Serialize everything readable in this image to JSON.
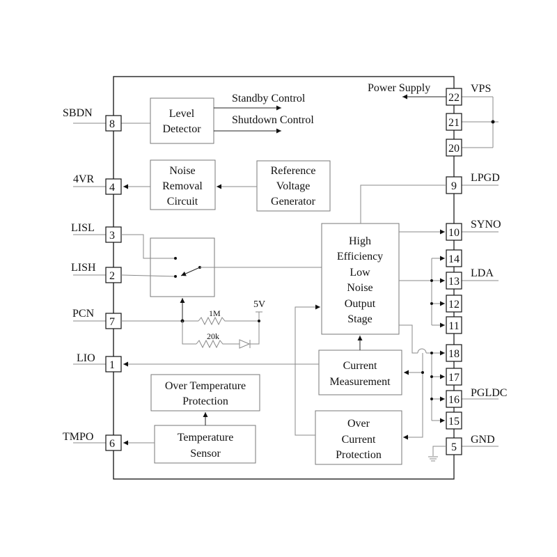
{
  "left_pins": [
    {
      "num": "8",
      "label": "SBDN"
    },
    {
      "num": "4",
      "label": "4VR"
    },
    {
      "num": "3",
      "label": "LISL"
    },
    {
      "num": "2",
      "label": "LISH"
    },
    {
      "num": "7",
      "label": "PCN"
    },
    {
      "num": "1",
      "label": "LIO"
    },
    {
      "num": "6",
      "label": "TMPO"
    }
  ],
  "right_pins": [
    "22",
    "21",
    "20",
    "9",
    "10",
    "14",
    "13",
    "12",
    "11",
    "18",
    "17",
    "16",
    "15",
    "5"
  ],
  "right_labels": {
    "vps": "VPS",
    "lpgd": "LPGD",
    "syno": "SYNO",
    "lda": "LDA",
    "pgldc": "PGLDC",
    "gnd": "GND"
  },
  "blocks": {
    "level_detector": [
      "Level",
      "Detector"
    ],
    "noise_removal": [
      "Noise",
      "Removal",
      "Circuit"
    ],
    "reference": [
      "Reference",
      "Voltage",
      "Generator"
    ],
    "output_stage": [
      "High",
      "Efficiency",
      "Low",
      "Noise",
      "Output",
      "Stage"
    ],
    "current_measurement": [
      "Current",
      "Measurement"
    ],
    "over_temp": [
      "Over Temperature",
      "Protection"
    ],
    "temp_sensor": [
      "Temperature",
      "Sensor"
    ],
    "over_current": [
      "Over",
      "Current",
      "Protection"
    ]
  },
  "signals": {
    "standby": "Standby Control",
    "shutdown": "Shutdown Control",
    "power_supply": "Power Supply",
    "v5": "5V",
    "r1": "1M",
    "r2": "20k"
  }
}
